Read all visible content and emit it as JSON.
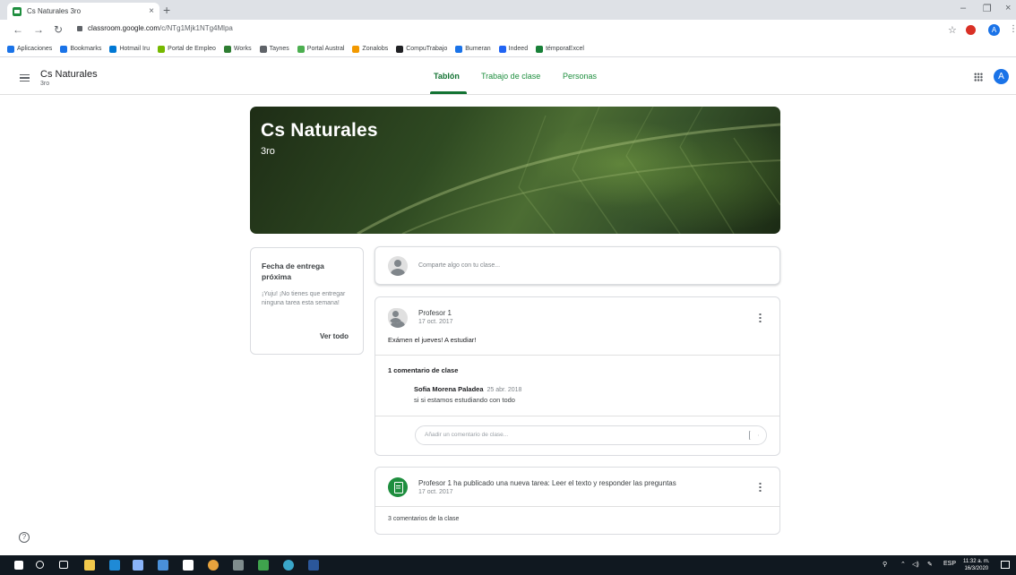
{
  "browser": {
    "tab_title": "Cs Naturales 3ro",
    "tab_close": "×",
    "new_tab": "+",
    "window_controls": [
      "–",
      "❐",
      "×"
    ],
    "url_host": "classroom.google.com",
    "url_path": "/c/NTg1Mjk1NTg4Mlpa",
    "bookmarks": [
      {
        "label": "Aplicaciones",
        "color": "#1a73e8"
      },
      {
        "label": "Bookmarks",
        "color": "#1a73e8"
      },
      {
        "label": "Hotmail Iru",
        "color": "#0078d4"
      },
      {
        "label": "Portal de Empleo",
        "color": "#76b900"
      },
      {
        "label": "Works",
        "color": "#2e7d32"
      },
      {
        "label": "Taynes",
        "color": "#5f6368"
      },
      {
        "label": "Portal Austral",
        "color": "#4caf50"
      },
      {
        "label": "Zonalobs",
        "color": "#f29900"
      },
      {
        "label": "CompuTrabajo",
        "color": "#202124"
      },
      {
        "label": "Bumeran",
        "color": "#1a73e8"
      },
      {
        "label": "Indeed",
        "color": "#2164f3"
      },
      {
        "label": "témporaExcel",
        "color": "#188038"
      }
    ],
    "profile_initial": "A"
  },
  "header": {
    "class_name": "Cs Naturales",
    "section": "3ro",
    "tabs": [
      "Tablón",
      "Trabajo de clase",
      "Personas"
    ],
    "account_initial": "A"
  },
  "banner": {
    "title": "Cs Naturales",
    "subtitle": "3ro"
  },
  "upcoming": {
    "title": "Fecha de entrega próxima",
    "text": "¡Yuju! ¡No tienes que entregar ninguna tarea esta semana!",
    "link": "Ver todo"
  },
  "share": {
    "placeholder": "Comparte algo con tu clase..."
  },
  "post": {
    "author": "Profesor 1",
    "date": "17 oct. 2017",
    "body": "Exámen el jueves! A estudiar!",
    "comments_count": "1 comentario de clase",
    "comment": {
      "author": "Sofia Morena Paladea",
      "date": "25 abr. 2018",
      "text": "si si estamos estudiando con todo"
    },
    "reply_placeholder": "Añadir un comentario de clase..."
  },
  "assignment": {
    "title": "Profesor 1 ha publicado una nueva tarea: Leer el texto y responder las preguntas",
    "date": "17 oct. 2017",
    "comments_count": "3 comentarios de la clase"
  },
  "help_icon": "?",
  "taskbar": {
    "language": "ESP",
    "time": "11:32 a. m.",
    "date": "16/3/2020"
  }
}
